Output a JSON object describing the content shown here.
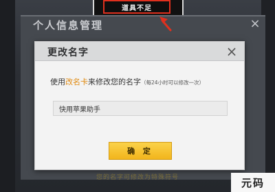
{
  "toast": {
    "text": "道具不足"
  },
  "background_panel": {
    "title": "个人信息管理",
    "close_glyph": "×",
    "footer_text": "您的名字可修改为特殊符号"
  },
  "dialog": {
    "title": "更改名字",
    "close_glyph": "×",
    "instruction": {
      "prefix": "使用",
      "highlight": "改名卡",
      "suffix": "来修改您的名字",
      "note": "（每24小时可以修改一次）"
    },
    "name_input": {
      "value": "快用苹果助手"
    },
    "confirm_label": "确 定"
  },
  "watermark": {
    "text": "元码"
  },
  "colors": {
    "toast_border": "#e0301e",
    "highlight": "#e08a10",
    "confirm_button": "#f2b51c"
  }
}
